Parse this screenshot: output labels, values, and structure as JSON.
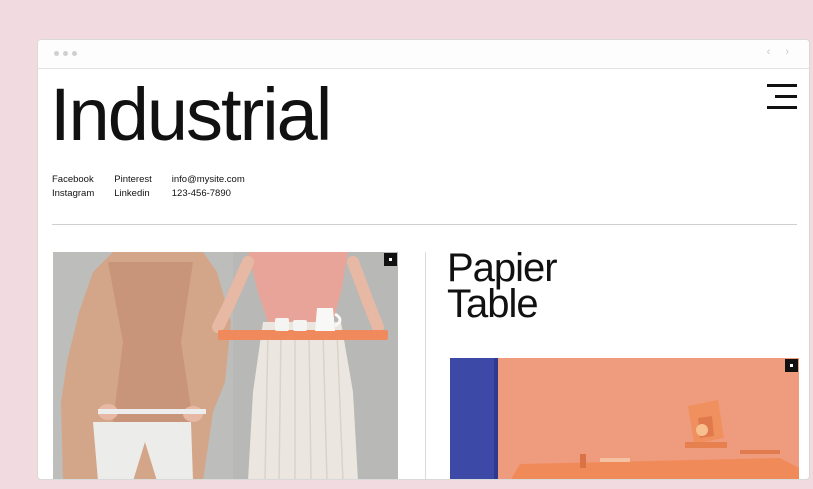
{
  "site": {
    "title": "Industrial"
  },
  "contacts": {
    "facebook": "Facebook",
    "pinterest": "Pinterest",
    "email": "info@mysite.com",
    "instagram": "Instagram",
    "linkedin": "Linkedin",
    "phone": "123-456-7890"
  },
  "product": {
    "title_line1": "Papier",
    "title_line2": "Table"
  },
  "browser": {
    "nav_arrows": "‹ ›"
  },
  "icons": {
    "menu": "hamburger-menu-icon",
    "photo_badge": "square-badge-icon"
  },
  "colors": {
    "page_bg": "#f1dbe1",
    "accent_coral": "#ef9a7c",
    "accent_blue": "#3d49a6"
  }
}
